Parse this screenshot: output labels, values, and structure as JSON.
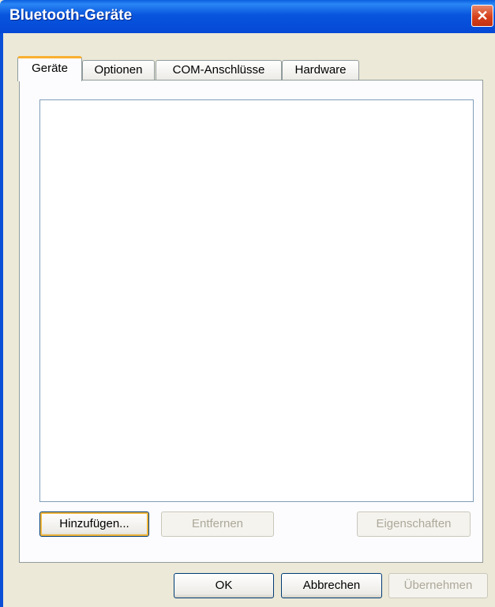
{
  "window": {
    "title": "Bluetooth-Geräte"
  },
  "tabs": [
    {
      "label": "Geräte",
      "selected": true
    },
    {
      "label": "Optionen",
      "selected": false
    },
    {
      "label": "COM-Anschlüsse",
      "selected": false
    },
    {
      "label": "Hardware",
      "selected": false
    }
  ],
  "panel": {
    "buttons": {
      "add": "Hinzufügen...",
      "remove": "Entfernen",
      "properties": "Eigenschaften"
    }
  },
  "footer": {
    "ok": "OK",
    "cancel": "Abbrechen",
    "apply": "Übernehmen"
  },
  "icons": {
    "close": "close-icon"
  },
  "colors": {
    "titlebar": "#0a5fde",
    "close": "#d6401c",
    "tab_highlight": "#f8b030"
  }
}
